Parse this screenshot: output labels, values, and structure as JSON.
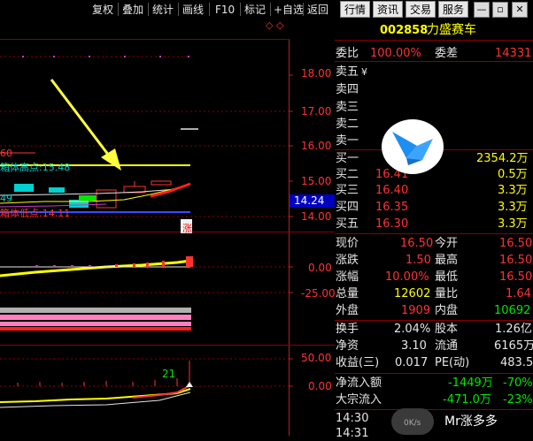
{
  "toolbar": {
    "items": [
      "复权",
      "叠加",
      "统计",
      "画线",
      "F10",
      "标记",
      "+自选",
      "返回"
    ],
    "right_buttons": [
      "行情",
      "资讯",
      "交易",
      "服务"
    ],
    "win_min": "—",
    "win_restore": "▫",
    "win_close": "✕"
  },
  "stock": {
    "code": "002858",
    "name": "力盛赛车"
  },
  "chart": {
    "main_axis": [
      "18.00",
      "17.00",
      "16.00",
      "15.00",
      "14.00"
    ],
    "price_tag": "14.24",
    "label_high": "箱体高点:15.48",
    "label_low": "箱体低点:14.11",
    "label_60": "60",
    "label_49": "49",
    "zhang_tag": "涨",
    "mid_axis": [
      "0.00",
      "-25.00"
    ],
    "low_axis": [
      "50.00",
      "0.00"
    ],
    "label_21": "21",
    "top_marks": "◇ ◇"
  },
  "orderbook": {
    "ratio_label": "委比",
    "ratio_value": "100.00%",
    "diff_label": "委差",
    "diff_value": "14331",
    "asks": [
      {
        "label": "卖五",
        "price": "",
        "vol": ""
      },
      {
        "label": "卖四",
        "price": "",
        "vol": ""
      },
      {
        "label": "卖三",
        "price": "",
        "vol": ""
      },
      {
        "label": "卖二",
        "price": "",
        "vol": ""
      },
      {
        "label": "卖一",
        "price": "",
        "vol": ""
      }
    ],
    "ask5_suffix": "¥",
    "bids": [
      {
        "label": "买一",
        "price": "",
        "vol": "2354.2万"
      },
      {
        "label": "买二",
        "price": "16.41",
        "vol": "0.5万"
      },
      {
        "label": "买三",
        "price": "16.40",
        "vol": "3.3万"
      },
      {
        "label": "买四",
        "price": "16.35",
        "vol": "3.3万"
      },
      {
        "label": "买五",
        "price": "16.30",
        "vol": "3.3万"
      }
    ]
  },
  "quote": {
    "rows": [
      {
        "l1": "现价",
        "v1": "16.50",
        "l2": "今开",
        "v2": "16.50"
      },
      {
        "l1": "涨跌",
        "v1": "1.50",
        "l2": "最高",
        "v2": "16.50"
      },
      {
        "l1": "涨幅",
        "v1": "10.00%",
        "l2": "最低",
        "v2": "16.50"
      },
      {
        "l1": "总量",
        "v1": "12602",
        "l2": "量比",
        "v2": "1.64"
      },
      {
        "l1": "外盘",
        "v1": "1909",
        "l2": "内盘",
        "v2": "10692"
      }
    ],
    "rows2": [
      {
        "l1": "换手",
        "v1": "2.04%",
        "l2": "股本",
        "v2": "1.26亿"
      },
      {
        "l1": "净资",
        "v1": "3.10",
        "l2": "流通",
        "v2": "6165万"
      },
      {
        "l1": "收益(三)",
        "v1": "0.017",
        "l2": "PE(动)",
        "v2": "483.5"
      }
    ],
    "flow": [
      {
        "l": "净流入额",
        "v1": "-1449万",
        "v2": "-70%"
      },
      {
        "l": "大宗流入",
        "v1": "-471.0万",
        "v2": "-23%"
      }
    ],
    "ticks": [
      "14:30",
      "14:31"
    ],
    "watermark": "Mr涨多多",
    "bottom_extra": "0K/s"
  },
  "colors": {
    "up": "#ff3232",
    "down": "#00e600",
    "axis": "#b22222",
    "label": "#e6e6e6"
  }
}
